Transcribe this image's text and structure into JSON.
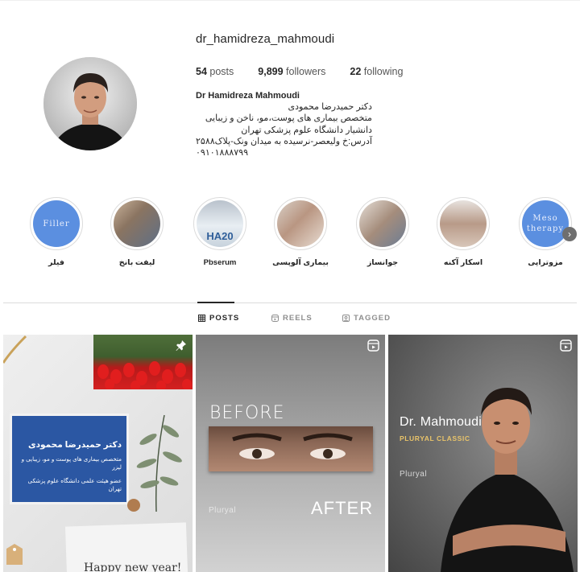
{
  "profile": {
    "username": "dr_hamidreza_mahmoudi",
    "stats": {
      "posts_count": "54",
      "posts_label": "posts",
      "followers_count": "9,899",
      "followers_label": "followers",
      "following_count": "22",
      "following_label": "following"
    },
    "bio": {
      "name": "Dr Hamidreza Mahmoudi",
      "line1": "دکتر حمیدرضا محمودی",
      "line2": "متخصص بیماری های پوست،مو، ناخن و زیبایی",
      "line3": "دانشیار دانشگاه علوم پزشکی تهران",
      "line4": "آدرس:خ ولیعصر-نرسیده به میدان ونک-پلاک۲۵۸۸",
      "line5": "۰۹۱۰۱۸۸۸۷۹۹"
    }
  },
  "highlights": [
    {
      "label": "فیلر",
      "cover_text": "Filler"
    },
    {
      "label": "لیفت بانخ",
      "cover_text": ""
    },
    {
      "label": "Pbserum",
      "cover_text": "HA20"
    },
    {
      "label": "بیماری آلوپسی",
      "cover_text": ""
    },
    {
      "label": "جوانساز",
      "cover_text": ""
    },
    {
      "label": "اسکار آکنه",
      "cover_text": ""
    },
    {
      "label": "مزوتراپی",
      "cover_text": "Meso therapy"
    }
  ],
  "tabs": {
    "posts": "POSTS",
    "reels": "REELS",
    "tagged": "TAGGED"
  },
  "posts": [
    {
      "card_title": "دکتر حمیدرضا محمودی",
      "card_line1": "متخصص بیماری های پوست و مو، زیبایی و لیزر",
      "card_line2": "عضو هیئت علمی دانشگاه علوم پزشکی تهران",
      "note_text": "Happy new year!",
      "icon": "pin-icon"
    },
    {
      "before": "BEFORE",
      "after": "AFTER",
      "brand": "Pluryal",
      "icon": "reel-icon"
    },
    {
      "title": "Dr. Mahmoudi",
      "subtitle": "PLURYAL CLASSIC",
      "brand": "Pluryal",
      "icon": "reel-icon"
    }
  ],
  "colors": {
    "highlight_blue": "#5b8fe0",
    "card_blue": "#2b57a3",
    "text": "#262626",
    "muted": "#8e8e8e"
  }
}
